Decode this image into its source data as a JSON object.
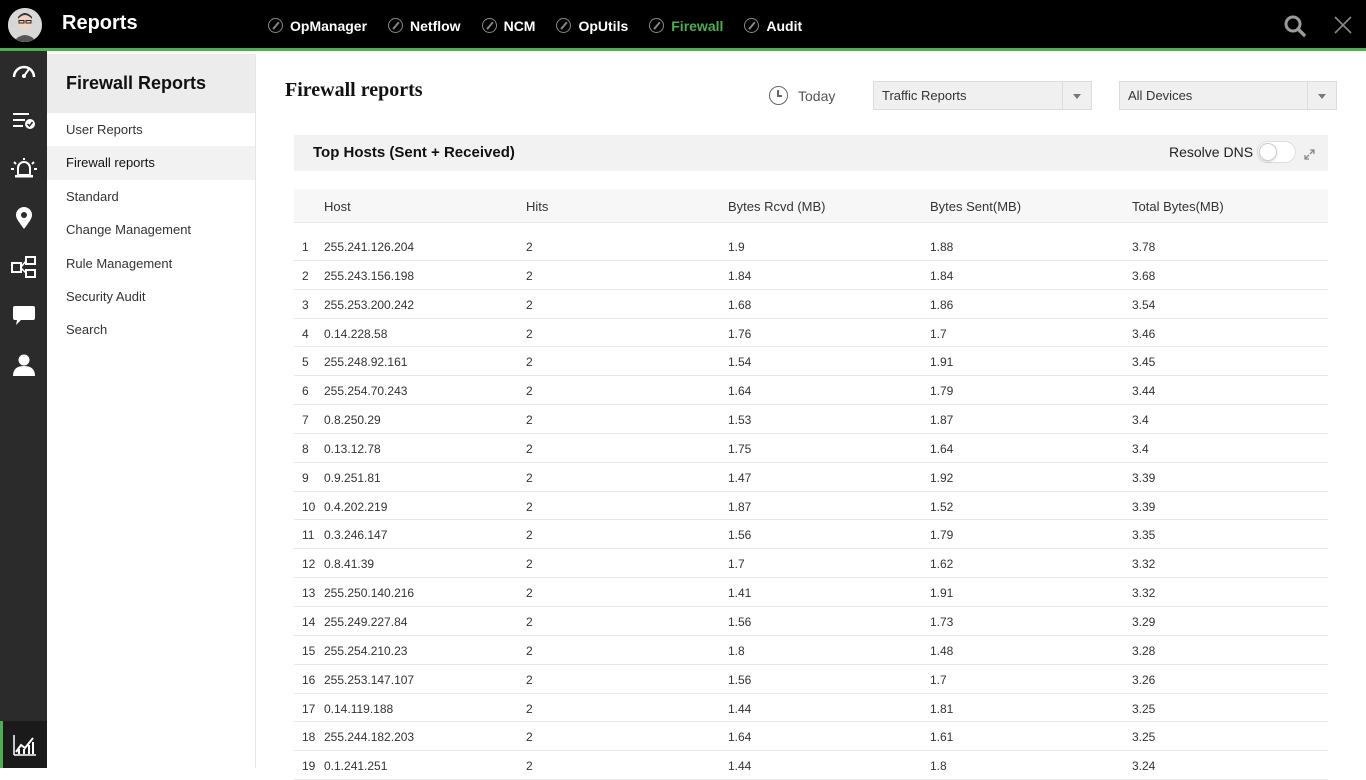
{
  "app": {
    "title": "Reports"
  },
  "topnav": {
    "items": [
      {
        "label": "OpManager",
        "active": false
      },
      {
        "label": "Netflow",
        "active": false
      },
      {
        "label": "NCM",
        "active": false
      },
      {
        "label": "OpUtils",
        "active": false
      },
      {
        "label": "Firewall",
        "active": true
      },
      {
        "label": "Audit",
        "active": false
      }
    ],
    "accent_color": "#4caf50"
  },
  "rail": {
    "icons": [
      "dashboard-icon",
      "inventory-icon",
      "alarms-icon",
      "maps-icon",
      "workflow-icon",
      "chat-icon",
      "user-icon",
      "reports-icon"
    ]
  },
  "subnav": {
    "title": "Firewall Reports",
    "items": [
      "User Reports",
      "Firewall reports",
      "Standard",
      "Change Management",
      "Rule Management",
      "Security Audit",
      "Search"
    ],
    "active_index": 1
  },
  "main": {
    "page_title": "Firewall reports",
    "period": "Today",
    "report_type": "Traffic Reports",
    "devices": "All Devices"
  },
  "widget": {
    "title": "Top Hosts (Sent + Received)",
    "resolve_dns_label": "Resolve DNS",
    "resolve_dns_on": false
  },
  "table": {
    "columns": [
      "Host",
      "Hits",
      "Bytes Rcvd (MB)",
      "Bytes Sent(MB)",
      "Total Bytes(MB)"
    ],
    "rows": [
      [
        "1",
        "255.241.126.204",
        "2",
        "1.9",
        "1.88",
        "3.78"
      ],
      [
        "2",
        "255.243.156.198",
        "2",
        "1.84",
        "1.84",
        "3.68"
      ],
      [
        "3",
        "255.253.200.242",
        "2",
        "1.68",
        "1.86",
        "3.54"
      ],
      [
        "4",
        "0.14.228.58",
        "2",
        "1.76",
        "1.7",
        "3.46"
      ],
      [
        "5",
        "255.248.92.161",
        "2",
        "1.54",
        "1.91",
        "3.45"
      ],
      [
        "6",
        "255.254.70.243",
        "2",
        "1.64",
        "1.79",
        "3.44"
      ],
      [
        "7",
        "0.8.250.29",
        "2",
        "1.53",
        "1.87",
        "3.4"
      ],
      [
        "8",
        "0.13.12.78",
        "2",
        "1.75",
        "1.64",
        "3.4"
      ],
      [
        "9",
        "0.9.251.81",
        "2",
        "1.47",
        "1.92",
        "3.39"
      ],
      [
        "10",
        "0.4.202.219",
        "2",
        "1.87",
        "1.52",
        "3.39"
      ],
      [
        "11",
        "0.3.246.147",
        "2",
        "1.56",
        "1.79",
        "3.35"
      ],
      [
        "12",
        "0.8.41.39",
        "2",
        "1.7",
        "1.62",
        "3.32"
      ],
      [
        "13",
        "255.250.140.216",
        "2",
        "1.41",
        "1.91",
        "3.32"
      ],
      [
        "14",
        "255.249.227.84",
        "2",
        "1.56",
        "1.73",
        "3.29"
      ],
      [
        "15",
        "255.254.210.23",
        "2",
        "1.8",
        "1.48",
        "3.28"
      ],
      [
        "16",
        "255.253.147.107",
        "2",
        "1.56",
        "1.7",
        "3.26"
      ],
      [
        "17",
        "0.14.119.188",
        "2",
        "1.44",
        "1.81",
        "3.25"
      ],
      [
        "18",
        "255.244.182.203",
        "2",
        "1.64",
        "1.61",
        "3.25"
      ],
      [
        "19",
        "0.1.241.251",
        "2",
        "1.44",
        "1.8",
        "3.24"
      ]
    ]
  }
}
